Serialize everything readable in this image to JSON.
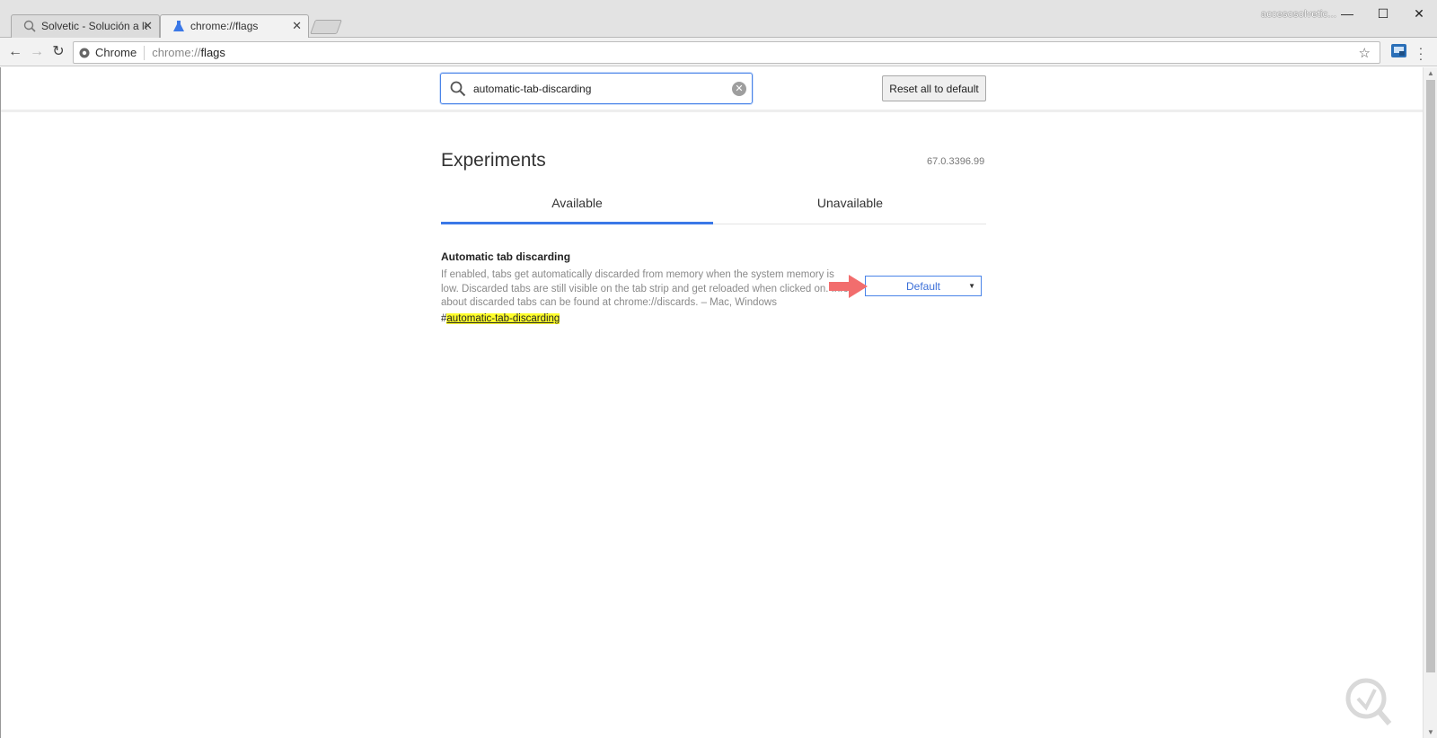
{
  "browser": {
    "tabs": [
      {
        "label": "Solvetic - Solución a los p",
        "active": false,
        "icon": "solvetic-favicon"
      },
      {
        "label": "chrome://flags",
        "active": true,
        "icon": "flask-icon"
      }
    ],
    "profile_name": "accesosolvetic...",
    "window_controls": {
      "minimize": "—",
      "maximize": "☐",
      "close": "✕"
    }
  },
  "toolbar": {
    "back": "←",
    "forward": "→",
    "reload": "↻",
    "site_chip": "Chrome",
    "url_scheme": "chrome://",
    "url_host": "flags",
    "bookmark_star": "☆"
  },
  "search": {
    "value": "automatic-tab-discarding",
    "reset_label": "Reset all to default"
  },
  "header": {
    "title": "Experiments",
    "version": "67.0.3396.99"
  },
  "content_tabs": {
    "available": "Available",
    "unavailable": "Unavailable"
  },
  "flag": {
    "name": "Automatic tab discarding",
    "description": "If enabled, tabs get automatically discarded from memory when the system memory is low. Discarded tabs are still visible on the tab strip and get reloaded when clicked on. Info about discarded tabs can be found at chrome://discards. – Mac, Windows",
    "link_hash": "#",
    "link_text": "automatic-tab-discarding",
    "selected_option": "Default"
  },
  "colors": {
    "accent": "#3b78e7",
    "highlight": "#ffff2c",
    "arrow": "#f26d6d"
  }
}
